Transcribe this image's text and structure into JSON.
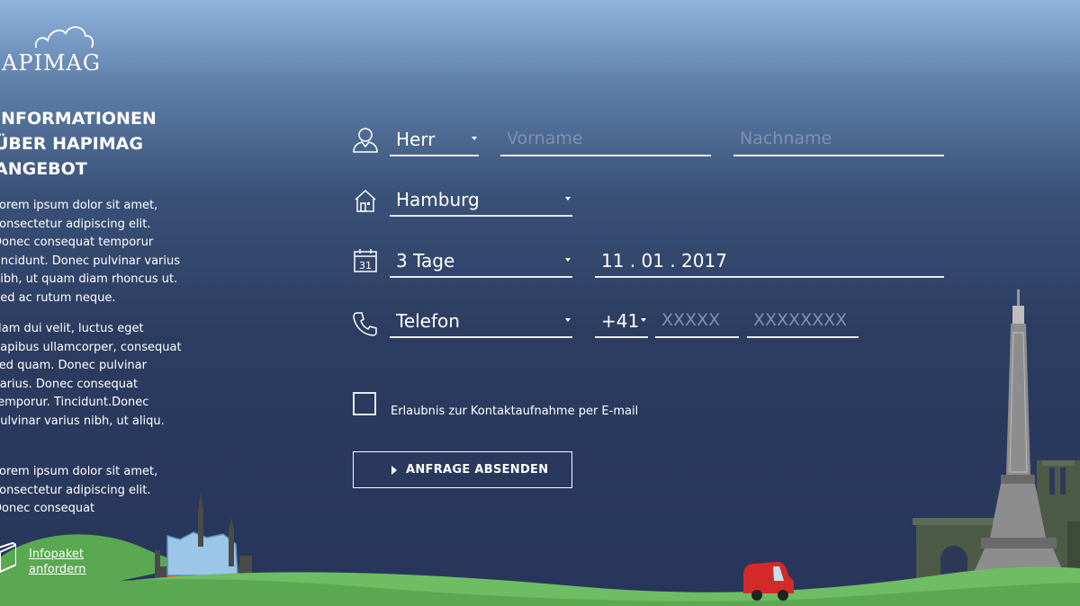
{
  "brand": {
    "logo_text": "APIMAG"
  },
  "sidebar": {
    "title": "INFORMATIONEN\nÜBER HAPIMAG\nANGEBOT",
    "paragraphs": [
      "Lorem ipsum dolor sit amet, consectetur adipiscing elit. Donec consequat temporur tincidunt. Donec pulvinar varius nibh, ut quam diam rhoncus ut. Sed ac rutum neque.",
      "Nam dui velit, luctus eget dapibus ullamcorper, consequat sed quam. Donec pulvinar varius. Donec consequat temporur. Tincidunt.Donec pulvinar varius nibh, ut aliqu.",
      "Lorem ipsum dolor sit amet, consectetur adipiscing elit. Donec consequat"
    ],
    "infopaket_link": "Infopaket\nanfordern"
  },
  "form": {
    "salutation": "Herr",
    "first_name_placeholder": "Vorname",
    "last_name_placeholder": "Nachname",
    "destination": "Hamburg",
    "duration": "3 Tage",
    "date": "11 . 01 . 2017",
    "contact_method": "Telefon",
    "country_code": "+41",
    "area_placeholder": "XXXXX",
    "number_placeholder": "XXXXXXXX",
    "consent_label": "Erlaubnis zur Kontaktaufnahme per E-mail",
    "submit_label": "ANFRAGE ABSENDEN"
  },
  "icons": [
    "cloud-logo-icon",
    "user-icon",
    "house-icon",
    "calendar-icon",
    "phone-icon",
    "package-icon",
    "caret-down-icon",
    "play-arrow-icon"
  ],
  "calendar_icon_day": "31",
  "colors": {
    "field_line": "#e6eaf2",
    "placeholder": "#7f91b2",
    "grass": "#6fbd63",
    "car": "#d42a2a"
  }
}
